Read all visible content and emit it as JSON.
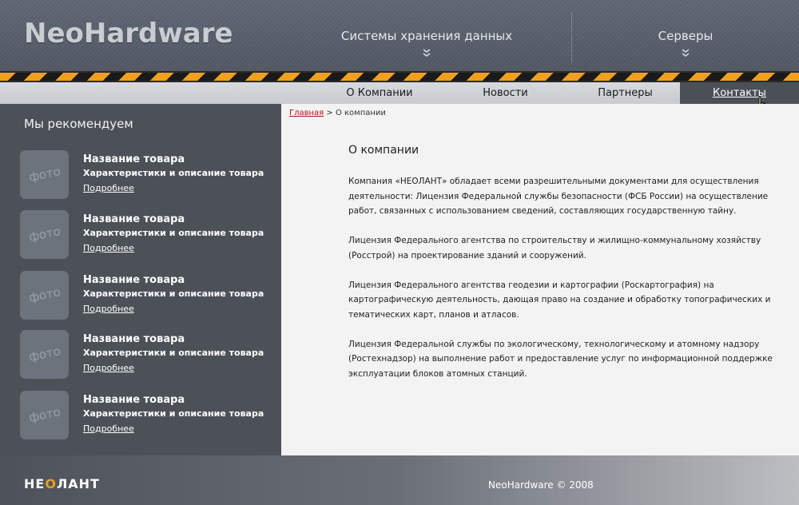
{
  "header": {
    "logo": "NeoHardware",
    "nav": [
      {
        "label": "Системы хранения данных"
      },
      {
        "label": "Серверы"
      }
    ]
  },
  "subnav": {
    "items": [
      {
        "label": "О Компании"
      },
      {
        "label": "Новости"
      },
      {
        "label": "Партнеры"
      },
      {
        "label": "Контакты"
      }
    ],
    "active": "Контакты"
  },
  "sidebar": {
    "title": "Мы рекомендуем",
    "products": [
      {
        "photo": "фото",
        "name": "Название товара",
        "desc": "Характеристики и описание товара",
        "more": "Подробнее"
      },
      {
        "photo": "фото",
        "name": "Название товара",
        "desc": "Характеристики и описание товара",
        "more": "Подробнее"
      },
      {
        "photo": "фото",
        "name": "Название товара",
        "desc": "Характеристики и описание товара",
        "more": "Подробнее"
      },
      {
        "photo": "фото",
        "name": "Название товара",
        "desc": "Характеристики и описание товара",
        "more": "Подробнее"
      },
      {
        "photo": "фото",
        "name": "Название товара",
        "desc": "Характеристики и описание товара",
        "more": "Подробнее"
      }
    ]
  },
  "breadcrumb": {
    "home": "Главная",
    "separator": ">",
    "current": "О компании"
  },
  "main": {
    "title": "О компании",
    "paragraphs": [
      "Компания «НЕОЛАНТ» обладает всеми разрешительными документами для осуществления деятельности: Лицензия Федеральной службы безопасности (ФСБ России) на осуществление работ, связанных с использованием сведений, составляющих государственную тайну.",
      "Лицензия Федерального агентства по строительству и жилищно-коммунальному хозяйству (Росстрой) на проектирование зданий и сооружений.",
      "Лицензия Федерального агентства геодезии и картографии (Роскартография) на картографическую деятельность, дающая право на создание и обработку топографических и тематических карт, планов и атласов.",
      "Лицензия Федеральной службы по экологическому, технологическому и атомному надзору (Ростехнадзор) на выполнение работ и предоставление услуг по информационной поддержке эксплуатации блоков атомных станций."
    ]
  },
  "footer": {
    "logo_pre": "НЕ",
    "logo_o": "О",
    "logo_post": "ЛАНТ",
    "copyright": "NeoHardware © 2008"
  },
  "colors": {
    "accent_orange": "#f0a020",
    "link_red": "#b3121f",
    "sidebar_bg": "#4c5158"
  }
}
